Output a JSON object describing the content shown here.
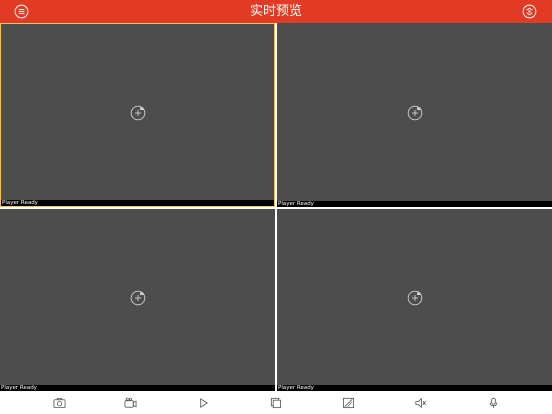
{
  "header": {
    "title": "实时预览",
    "background_color": "#e23b25",
    "left_icon": "menu-icon",
    "right_icon": "camera-switch-icon"
  },
  "players": [
    {
      "status": "Player Ready",
      "selected": true,
      "action_icon": "add-camera-icon"
    },
    {
      "status": "Player Ready",
      "selected": false,
      "action_icon": "add-camera-icon"
    },
    {
      "status": "Player Ready",
      "selected": false,
      "action_icon": "add-camera-icon"
    },
    {
      "status": "Player Ready",
      "selected": false,
      "action_icon": "add-camera-icon"
    }
  ],
  "toolbar": {
    "items": [
      {
        "icon": "snapshot-icon"
      },
      {
        "icon": "record-icon"
      },
      {
        "icon": "play-icon"
      },
      {
        "icon": "window-split-icon"
      },
      {
        "icon": "image-quality-icon"
      },
      {
        "icon": "mute-icon"
      },
      {
        "icon": "microphone-icon"
      }
    ]
  },
  "colors": {
    "player_background": "#4d4d4d",
    "selected_border": "#f2c15f",
    "icon_color": "#555555"
  }
}
